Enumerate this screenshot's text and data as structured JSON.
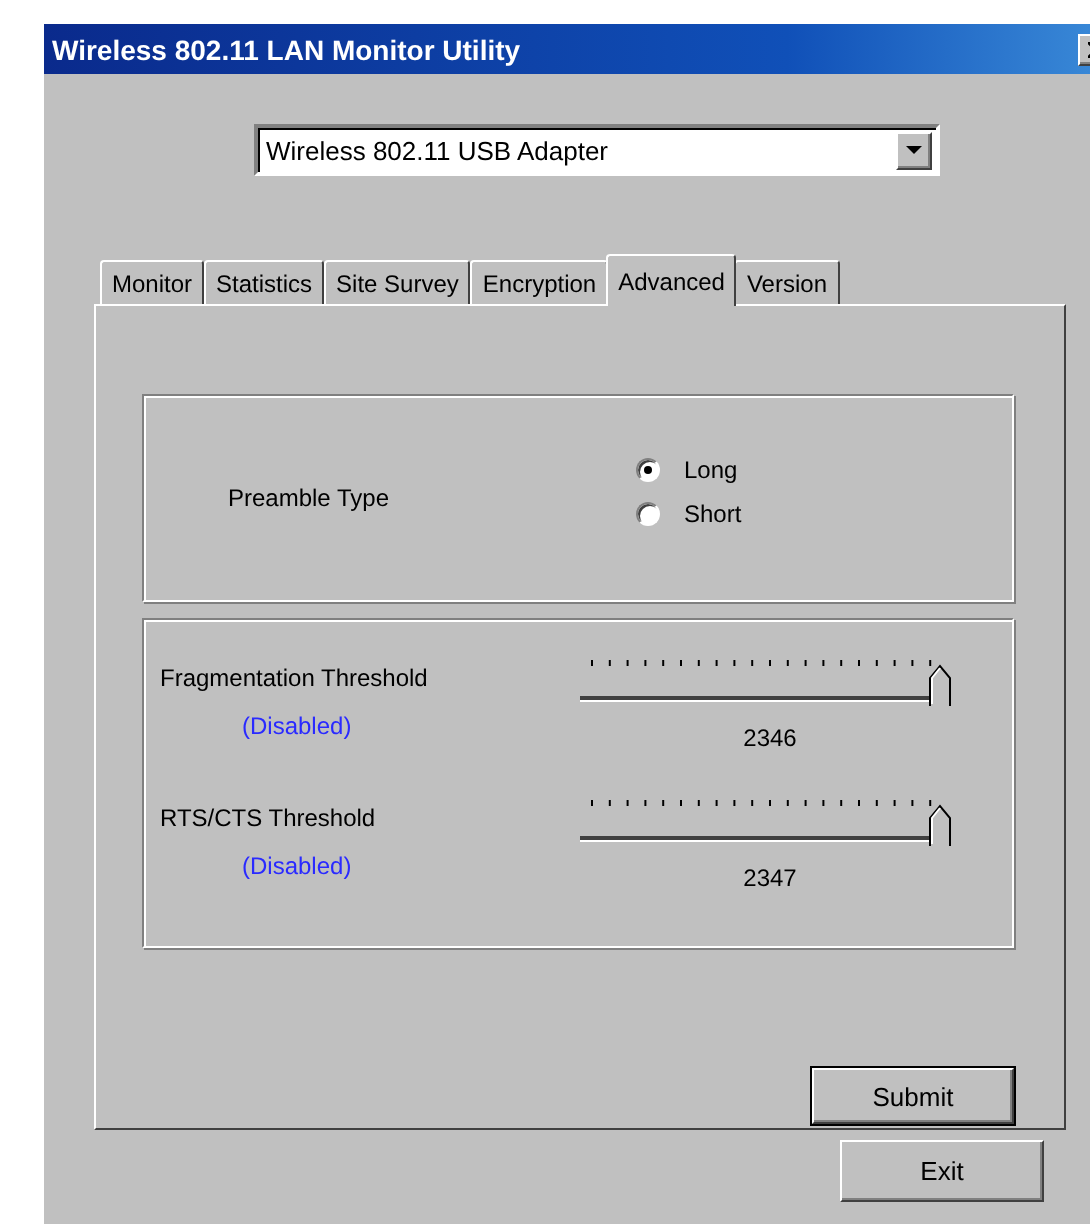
{
  "window": {
    "title": "Wireless 802.11 LAN Monitor Utility"
  },
  "adapter": {
    "value": "Wireless 802.11 USB Adapter"
  },
  "tabs": [
    {
      "label": "Monitor",
      "selected": false
    },
    {
      "label": "Statistics",
      "selected": false
    },
    {
      "label": "Site Survey",
      "selected": false
    },
    {
      "label": "Encryption",
      "selected": false
    },
    {
      "label": "Advanced",
      "selected": true
    },
    {
      "label": "Version",
      "selected": false
    }
  ],
  "preamble": {
    "label": "Preamble Type",
    "options": [
      {
        "label": "Long",
        "selected": true
      },
      {
        "label": "Short",
        "selected": false
      }
    ]
  },
  "thresholds": [
    {
      "name": "Fragmentation Threshold",
      "status": "(Disabled)",
      "reading": "2346"
    },
    {
      "name": "RTS/CTS Threshold",
      "status": "(Disabled)",
      "reading": "2347"
    }
  ],
  "buttons": {
    "submit": "Submit",
    "exit": "Exit"
  }
}
